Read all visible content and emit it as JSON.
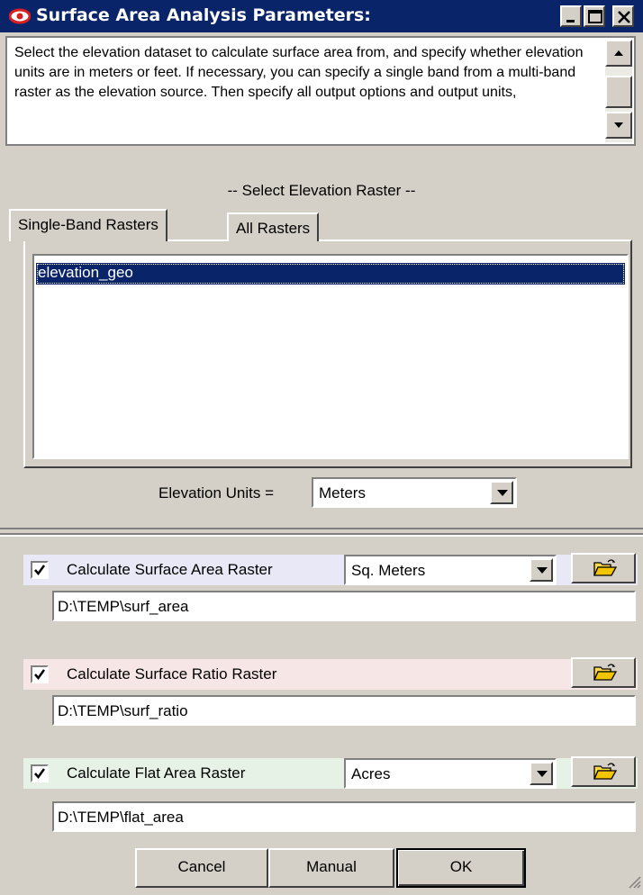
{
  "window": {
    "title": "Surface Area Analysis Parameters:"
  },
  "description": "Select the elevation dataset to calculate surface area from, and specify whether elevation units are in meters or feet. If necessary, you can specify a single band from a multi-band raster as the elevation source. Then specify all output options and output units,",
  "raster_section": {
    "heading": "-- Select Elevation Raster --",
    "tabs": [
      "Single-Band Rasters",
      "All Rasters"
    ],
    "items": [
      "elevation_geo"
    ],
    "selected_index": 0
  },
  "elevation_units": {
    "label": "Elevation Units =",
    "value": "Meters"
  },
  "outputs": [
    {
      "label": "Calculate Surface Area Raster",
      "checked": true,
      "unit": "Sq. Meters",
      "path": "D:\\TEMP\\surf_area",
      "color": "#e8e8f6"
    },
    {
      "label": "Calculate Surface Ratio Raster",
      "checked": true,
      "unit": null,
      "path": "D:\\TEMP\\surf_ratio",
      "color": "#f6e6e6"
    },
    {
      "label": "Calculate Flat Area Raster",
      "checked": true,
      "unit": "Acres",
      "path": "D:\\TEMP\\flat_area",
      "color": "#e6f2e6"
    }
  ],
  "buttons": {
    "cancel": "Cancel",
    "manual": "Manual",
    "ok": "OK"
  },
  "colors": {
    "title_bar": "#0a246a",
    "face": "#d4d0c8",
    "selection": "#0a246a",
    "title_icon": "#d92020"
  },
  "icons": {
    "title": "eye-icon",
    "folder": "open-folder-icon"
  }
}
